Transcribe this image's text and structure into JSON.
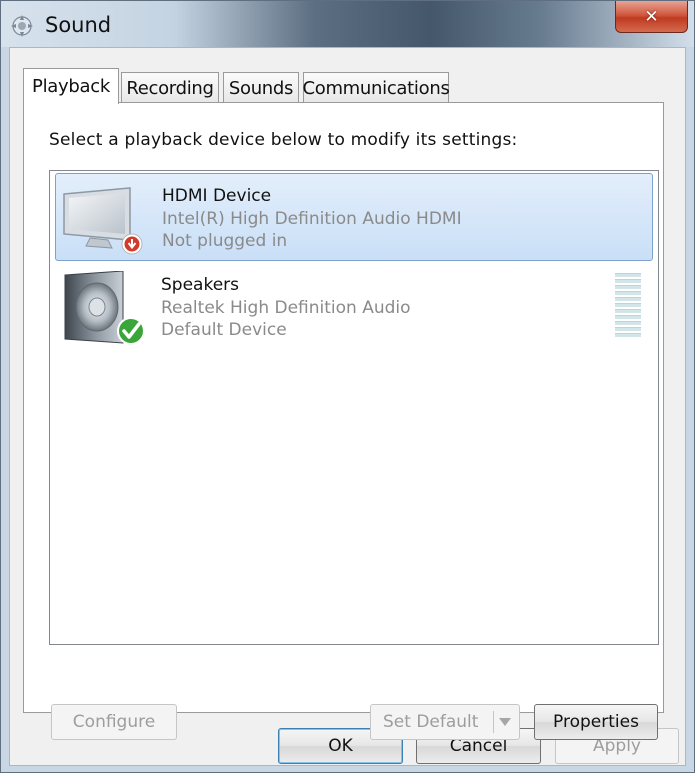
{
  "window": {
    "title": "Sound",
    "close_glyph": "✕"
  },
  "tabs": [
    {
      "label": "Playback",
      "active": true
    },
    {
      "label": "Recording",
      "active": false
    },
    {
      "label": "Sounds",
      "active": false
    },
    {
      "label": "Communications",
      "active": false
    }
  ],
  "playback": {
    "instruction": "Select a playback device below to modify its settings:",
    "devices": [
      {
        "name": "HDMI Device",
        "driver": "Intel(R) High Definition Audio HDMI",
        "status": "Not plugged in",
        "icon": "monitor-icon",
        "badge": "unplugged-badge-icon",
        "selected": true
      },
      {
        "name": "Speakers",
        "driver": "Realtek High Definition Audio",
        "status": "Default Device",
        "icon": "speaker-icon",
        "badge": "default-check-badge-icon",
        "selected": false,
        "level": 0
      }
    ],
    "buttons": {
      "configure": "Configure",
      "set_default": "Set Default",
      "properties": "Properties"
    }
  },
  "dialog_buttons": {
    "ok": "OK",
    "cancel": "Cancel",
    "apply": "Apply"
  },
  "colors": {
    "selection": "#cce0f8",
    "secondary_text": "#8a8a8a",
    "close_button": "#c9462c",
    "check_green": "#3aa63a",
    "unplugged_red": "#d23a2a"
  }
}
